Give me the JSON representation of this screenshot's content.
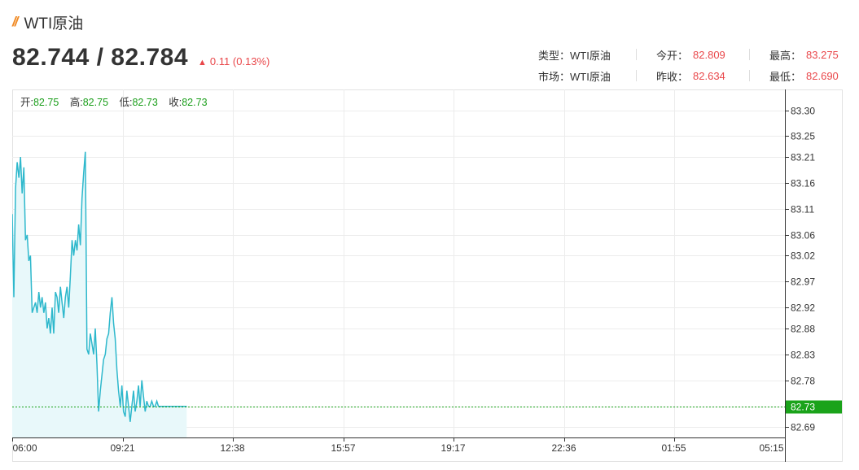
{
  "header": {
    "title": "WTI原油",
    "price": "82.744 / 82.784",
    "change_arrow": "▲",
    "change_text": "0.11 (0.13%)"
  },
  "info": {
    "type_label": "类型：",
    "type_value": "WTI原油",
    "market_label": "市场：",
    "market_value": "WTI原油",
    "open_label": "今开：",
    "open_value": "82.809",
    "prev_close_label": "昨收：",
    "prev_close_value": "82.634",
    "high_label": "最高：",
    "high_value": "83.275",
    "low_label": "最低：",
    "low_value": "82.690"
  },
  "ohlc": {
    "open_label": "开:",
    "open_value": "82.75",
    "high_label": "高:",
    "high_value": "82.75",
    "low_label": "低:",
    "low_value": "82.73",
    "close_label": "收:",
    "close_value": "82.73"
  },
  "colors": {
    "line": "#2eb8cc",
    "fill": "#e8f8fa",
    "up": "#e9474a",
    "ohlc_value": "#1a9e1a",
    "current": "#1aa31a"
  },
  "chart_data": {
    "type": "area",
    "title": "",
    "xlabel": "",
    "ylabel": "",
    "y_ticks": [
      "83.30",
      "83.25",
      "83.21",
      "83.16",
      "83.11",
      "83.06",
      "83.02",
      "82.97",
      "82.92",
      "82.88",
      "82.83",
      "82.78",
      "82.73",
      "82.69"
    ],
    "y_tick_values": [
      83.3,
      83.25,
      83.21,
      83.16,
      83.11,
      83.06,
      83.02,
      82.97,
      82.92,
      82.88,
      82.83,
      82.78,
      82.73,
      82.69
    ],
    "x_ticks": [
      "06:00",
      "09:21",
      "12:38",
      "15:57",
      "19:17",
      "22:36",
      "01:55",
      "05:15"
    ],
    "ylim": [
      82.67,
      83.34
    ],
    "xlim_minutes": [
      0,
      1395
    ],
    "current_value": 82.73,
    "current_label": "82.73",
    "x_minutes": [
      0,
      3,
      6,
      9,
      12,
      15,
      18,
      21,
      24,
      27,
      30,
      33,
      36,
      39,
      42,
      45,
      48,
      51,
      54,
      57,
      60,
      63,
      66,
      69,
      72,
      75,
      78,
      81,
      84,
      87,
      90,
      93,
      96,
      99,
      102,
      105,
      108,
      111,
      114,
      117,
      120,
      123,
      126,
      129,
      132,
      135,
      138,
      141,
      144,
      147,
      150,
      153,
      156,
      159,
      162,
      165,
      168,
      171,
      174,
      177,
      180,
      183,
      186,
      189,
      192,
      195,
      198,
      201,
      204,
      207,
      210,
      213,
      216,
      219,
      222,
      225,
      228,
      231,
      234,
      237,
      240,
      243,
      246,
      249,
      252,
      255,
      258,
      261,
      264,
      267,
      270,
      273,
      276,
      279,
      282,
      285,
      288,
      291,
      294,
      297,
      300,
      303,
      306,
      309,
      312,
      315
    ],
    "y": [
      83.1,
      82.94,
      83.15,
      83.2,
      83.17,
      83.21,
      83.14,
      83.19,
      83.05,
      83.06,
      83.01,
      83.02,
      82.91,
      82.92,
      82.93,
      82.91,
      82.95,
      82.92,
      82.94,
      82.91,
      82.93,
      82.88,
      82.9,
      82.87,
      82.92,
      82.87,
      82.95,
      82.94,
      82.91,
      82.96,
      82.93,
      82.9,
      82.94,
      82.96,
      82.92,
      82.98,
      83.05,
      83.02,
      83.05,
      83.03,
      83.08,
      83.04,
      83.13,
      83.18,
      83.22,
      82.84,
      82.83,
      82.87,
      82.85,
      82.83,
      82.88,
      82.81,
      82.72,
      82.76,
      82.79,
      82.82,
      82.83,
      82.86,
      82.87,
      82.91,
      82.94,
      82.89,
      82.86,
      82.8,
      82.76,
      82.73,
      82.77,
      82.72,
      82.71,
      82.76,
      82.73,
      82.7,
      82.73,
      82.76,
      82.72,
      82.74,
      82.77,
      82.73,
      82.78,
      82.75,
      82.72,
      82.74,
      82.73,
      82.73,
      82.74,
      82.73,
      82.73,
      82.74,
      82.73,
      82.73,
      82.73,
      82.73,
      82.73,
      82.73,
      82.73,
      82.73,
      82.73,
      82.73,
      82.73,
      82.73,
      82.73,
      82.73,
      82.73,
      82.73,
      82.73,
      82.73
    ]
  }
}
